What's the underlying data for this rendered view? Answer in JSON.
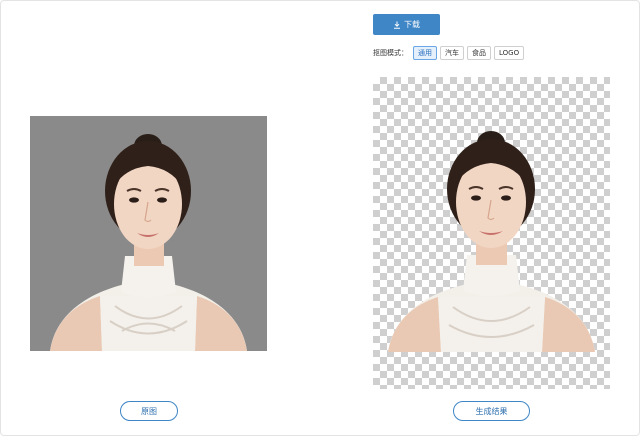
{
  "toolbar": {
    "download_label": "下载",
    "download_icon": "download-icon",
    "accent_color": "#3f86c7"
  },
  "mode": {
    "label": "抠图模式：",
    "options": [
      "通用",
      "汽车",
      "食品",
      "LOGO"
    ],
    "selected": "通用"
  },
  "buttons": {
    "original_label": "原图",
    "result_label": "生成结果"
  }
}
